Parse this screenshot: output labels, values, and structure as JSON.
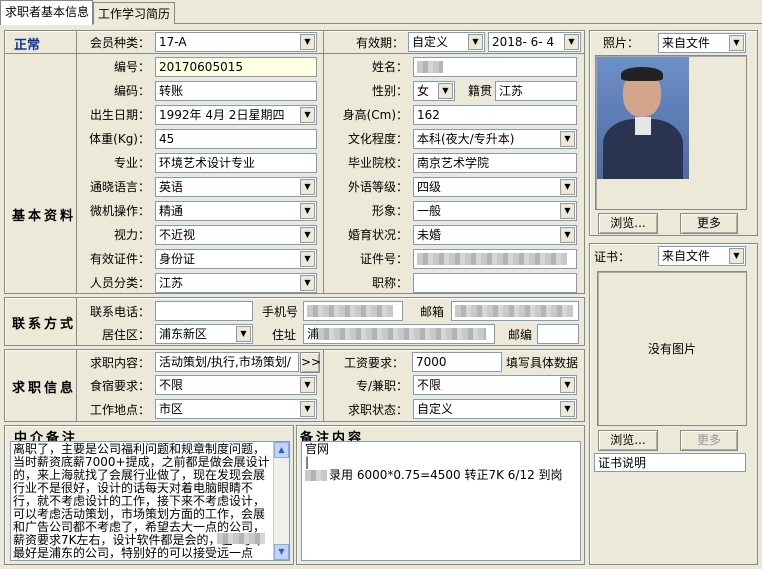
{
  "tabs": [
    "求职者基本信息",
    "工作学习简历"
  ],
  "status": "正常",
  "member_type": {
    "label": "会员种类：",
    "value": "17-A"
  },
  "validity": {
    "label": "有效期：",
    "mode": "自定义",
    "date": "2018- 6- 4"
  },
  "sections": {
    "basic": "基本资料",
    "contact": "联系方式",
    "job": "求职信息",
    "agency_memo": "中介备注",
    "remarks": "备注内容"
  },
  "fields": {
    "number": {
      "label": "编号：",
      "value": "20170605015"
    },
    "code": {
      "label": "编码：",
      "value": "转账"
    },
    "birth": {
      "label": "出生日期：",
      "value": "1992年 4月 2日星期四"
    },
    "weight": {
      "label": "体重(Kg)：",
      "value": "45"
    },
    "major": {
      "label": "专业：",
      "value": "环境艺术设计专业"
    },
    "language": {
      "label": "通晓语言：",
      "value": "英语"
    },
    "computer": {
      "label": "微机操作：",
      "value": "精通"
    },
    "vision": {
      "label": "视力：",
      "value": "不近视"
    },
    "id_type": {
      "label": "有效证件：",
      "value": "身份证"
    },
    "category": {
      "label": "人员分类：",
      "value": "江苏"
    },
    "name": {
      "label": "姓名：",
      "value": ""
    },
    "gender": {
      "label": "性别：",
      "value": "女"
    },
    "native": {
      "label": "籍贯",
      "value": "江苏"
    },
    "height": {
      "label": "身高(Cm)：",
      "value": "162"
    },
    "education": {
      "label": "文化程度：",
      "value": "本科(夜大/专升本)"
    },
    "school": {
      "label": "毕业院校：",
      "value": "南京艺术学院"
    },
    "foreign_level": {
      "label": "外语等级：",
      "value": "四级"
    },
    "appearance": {
      "label": "形象：",
      "value": "一般"
    },
    "marital": {
      "label": "婚育状况：",
      "value": "未婚"
    },
    "id_number": {
      "label": "证件号：",
      "value": ""
    },
    "title": {
      "label": "职称：",
      "value": ""
    }
  },
  "contact": {
    "phone_label": "联系电话：",
    "phone": "",
    "mobile_label": "手机号",
    "mobile": "",
    "email_label": "邮箱",
    "email": "",
    "district_label": "居住区：",
    "district": "浦东新区",
    "address_label": "住址",
    "address": "浦",
    "zip_label": "邮编",
    "zip": ""
  },
  "job": {
    "content_label": "求职内容：",
    "content": "活动策划/执行,市场策划/",
    "more_btn": ">>",
    "salary_label": "工资要求：",
    "salary": "7000",
    "salary_hint": "填写具体数据",
    "board_label": "食宿要求：",
    "board": "不限",
    "parttime_label": "专/兼职：",
    "parttime": "不限",
    "location_label": "工作地点：",
    "location": "市区",
    "status_label": "求职状态：",
    "status": "自定义"
  },
  "agency_memo_text": "离职了，主要是公司福利问题和规章制度问题，当时薪资底薪7000+提成，之前都是做会展设计的，来上海就找了会展行业做了，现在发现会展行业不是很好，设计的话每天对着电脑眼睛不行，就不考虑设计的工作，接下来不考虑设计，可以考虑活动策划，市场策划方面的工作，会展和广告公司都不考虑了，希望去大一点的公司，薪资要求7K左右，设计软件都是会的，住2号      ，最好是浦东的公司，特别好的可以接受远一点",
  "remarks_text": {
    "line1": "官网",
    "line3": "录用 6000*0.75=4500 转正7K 6/12 到岗"
  },
  "photo": {
    "label": "照片：",
    "source": "来自文件",
    "browse": "浏览...",
    "more": "更多"
  },
  "certificate": {
    "label": "证书：",
    "source": "来自文件",
    "empty": "没有图片",
    "browse": "浏览...",
    "more": "更多",
    "desc": "证书说明"
  }
}
